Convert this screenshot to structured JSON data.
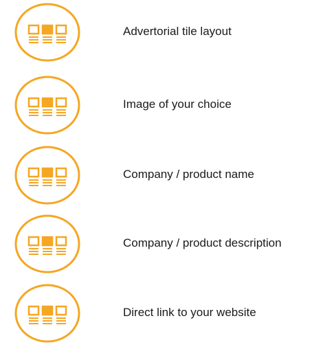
{
  "accent_color": "#f5a623",
  "features": [
    {
      "icon": "tile-layout-icon",
      "label": "Advertorial tile layout"
    },
    {
      "icon": "tile-layout-icon",
      "label": "Image of your choice"
    },
    {
      "icon": "tile-layout-icon",
      "label": "Company / product name"
    },
    {
      "icon": "tile-layout-icon",
      "label": "Company / product description"
    },
    {
      "icon": "tile-layout-icon",
      "label": "Direct link to your website"
    }
  ]
}
